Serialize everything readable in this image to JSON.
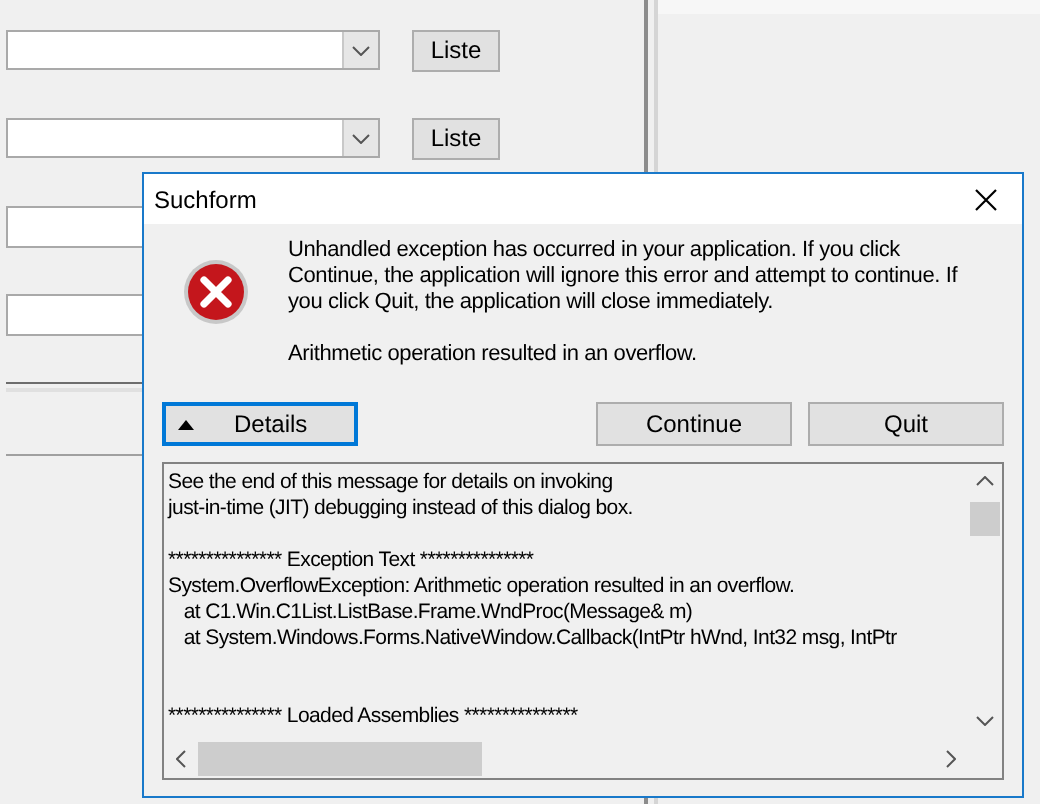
{
  "form": {
    "list_buttons": [
      "Liste",
      "Liste"
    ]
  },
  "dialog": {
    "title": "Suchform",
    "message": "Unhandled exception has occurred in your application. If you click Continue, the application will ignore this error and attempt to continue. If you click Quit, the application will close immediately.",
    "error": "Arithmetic operation resulted in an overflow.",
    "details_button": "Details",
    "buttons": [
      "Continue",
      "Quit"
    ],
    "details_blocks": [
      [
        "See the end of this message for details on invoking",
        "just-in-time (JIT) debugging instead of this dialog box."
      ],
      [
        "*************** Exception Text ***************",
        "System.OverflowException: Arithmetic operation resulted in an overflow.",
        "   at C1.Win.C1List.ListBase.Frame.WndProc(Message& m)",
        "   at System.Windows.Forms.NativeWindow.Callback(IntPtr hWnd, Int32 msg, IntPtr"
      ],
      [
        "*************** Loaded Assemblies ***************"
      ]
    ]
  }
}
